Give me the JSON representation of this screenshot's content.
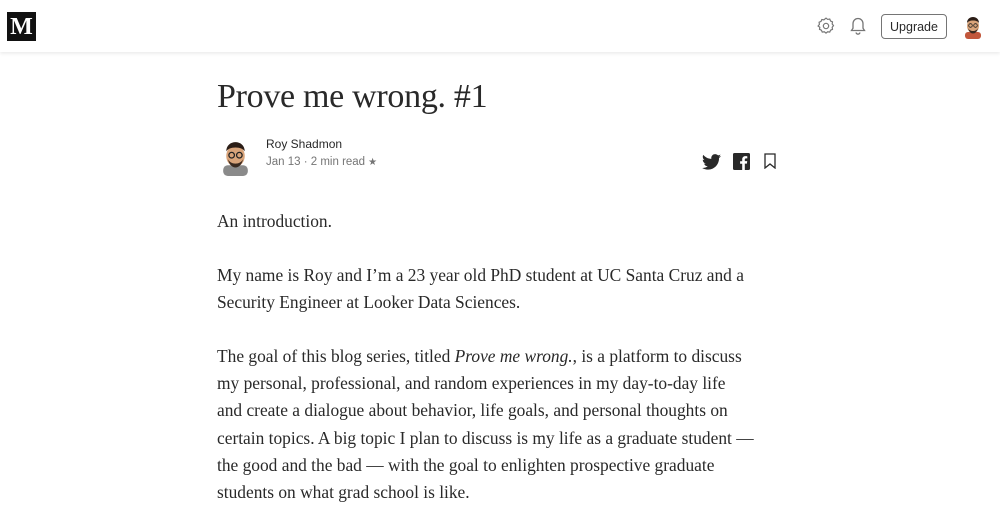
{
  "header": {
    "logo_text": "M",
    "upgrade_label": "Upgrade",
    "icons": [
      "gear-icon",
      "bell-icon",
      "avatar"
    ]
  },
  "article": {
    "title": "Prove me wrong. #1",
    "author": {
      "name": "Roy Shadmon",
      "meta": "Jan 13 · 2 min read",
      "star": "★"
    },
    "share_icons": [
      "twitter-icon",
      "facebook-icon",
      "bookmark-icon"
    ],
    "paragraphs": {
      "p1": "An introduction.",
      "p2_line1": "My name is Roy and I’m a 23 year old PhD student at UC Santa Cruz and a",
      "p2_line2": "Security Engineer at Looker Data Sciences.",
      "p3_before": "The goal of this blog series, titled ",
      "p3_italic": "Prove me wrong.",
      "p3_line1_after": ", is a platform to discuss",
      "p3_line2": "my personal, professional, and random experiences in my day-to-day life",
      "p3_line3": "and create a dialogue about behavior, life goals, and personal thoughts on",
      "p3_line4": "certain topics. A big topic I plan to discuss is my life as a graduate student —",
      "p3_line5": "the good and the bad — with the goal to enlighten prospective graduate",
      "p3_line6": "students on what grad school is like."
    }
  },
  "colors": {
    "text": "#292929",
    "muted": "#757575",
    "logo_bg": "#111111"
  }
}
